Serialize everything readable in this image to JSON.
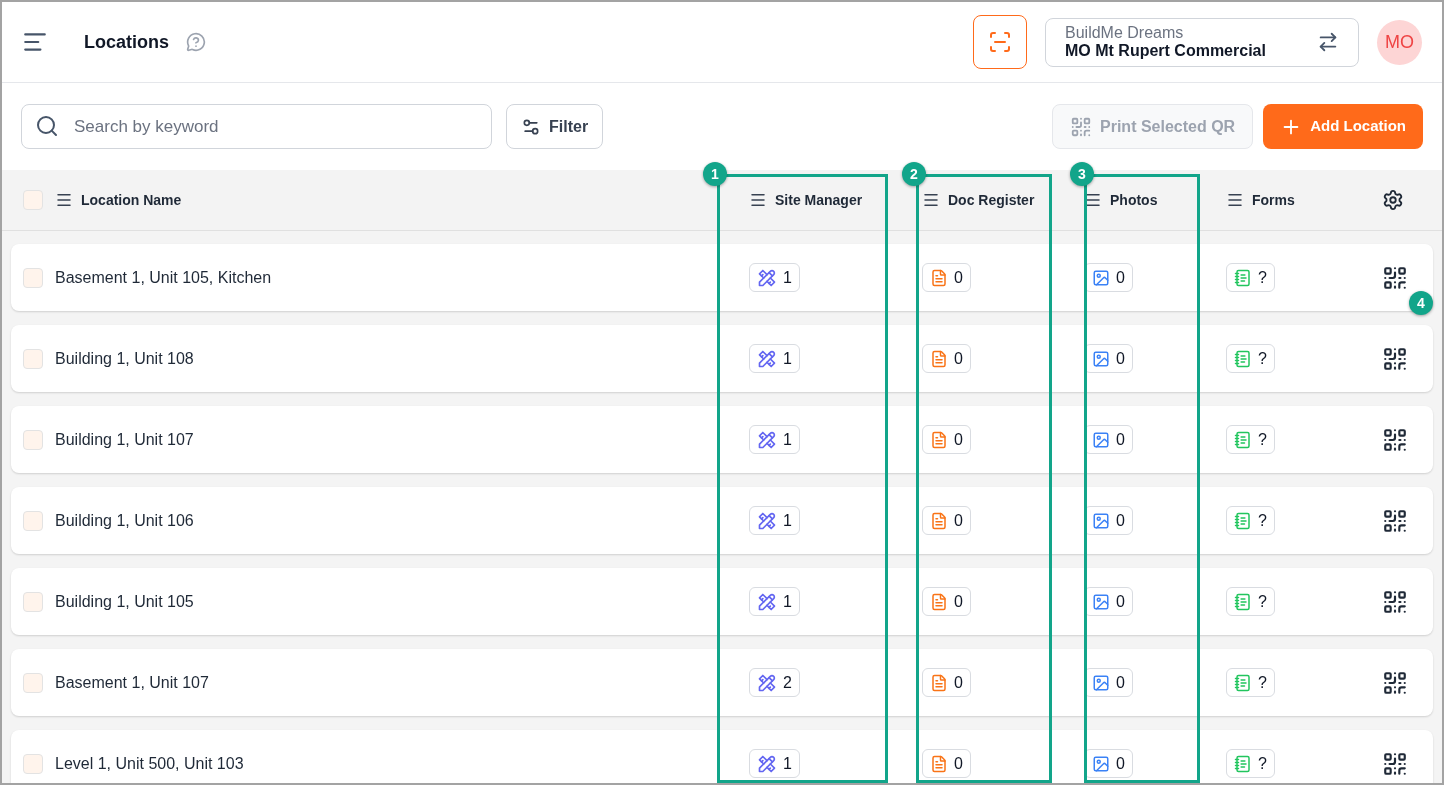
{
  "header": {
    "title": "Locations",
    "company": "BuildMe Dreams",
    "project": "MO Mt Rupert Commercial",
    "avatar": "MO"
  },
  "toolbar": {
    "search": {
      "placeholder": "Search by keyword"
    },
    "filter": "Filter",
    "print_qr": {
      "label": "Print Selected QR",
      "disabled": true
    },
    "add": "Add Location"
  },
  "table": {
    "select_all": {
      "checked": false
    },
    "columns": [
      "Location Name",
      "Site Manager",
      "Doc Register",
      "Photos",
      "Forms"
    ],
    "rows": [
      {
        "name": "Basement 1, Unit 105, Kitchen",
        "checked": false,
        "site_manager": "1",
        "doc_register": "0",
        "photos": "0",
        "forms": "?"
      },
      {
        "name": "Building 1, Unit 108",
        "checked": false,
        "site_manager": "1",
        "doc_register": "0",
        "photos": "0",
        "forms": "?"
      },
      {
        "name": "Building 1, Unit 107",
        "checked": false,
        "site_manager": "1",
        "doc_register": "0",
        "photos": "0",
        "forms": "?"
      },
      {
        "name": "Building 1, Unit 106",
        "checked": false,
        "site_manager": "1",
        "doc_register": "0",
        "photos": "0",
        "forms": "?"
      },
      {
        "name": "Building 1, Unit 105",
        "checked": false,
        "site_manager": "1",
        "doc_register": "0",
        "photos": "0",
        "forms": "?"
      },
      {
        "name": "Basement 1, Unit 107",
        "checked": false,
        "site_manager": "2",
        "doc_register": "0",
        "photos": "0",
        "forms": "?"
      },
      {
        "name": "Level 1, Unit 500, Unit 103",
        "checked": false,
        "site_manager": "1",
        "doc_register": "0",
        "photos": "0",
        "forms": "?"
      }
    ]
  },
  "annotations": [
    {
      "label": "1",
      "kind": "box"
    },
    {
      "label": "2",
      "kind": "box"
    },
    {
      "label": "3",
      "kind": "box"
    },
    {
      "label": "4",
      "kind": "marker"
    }
  ]
}
